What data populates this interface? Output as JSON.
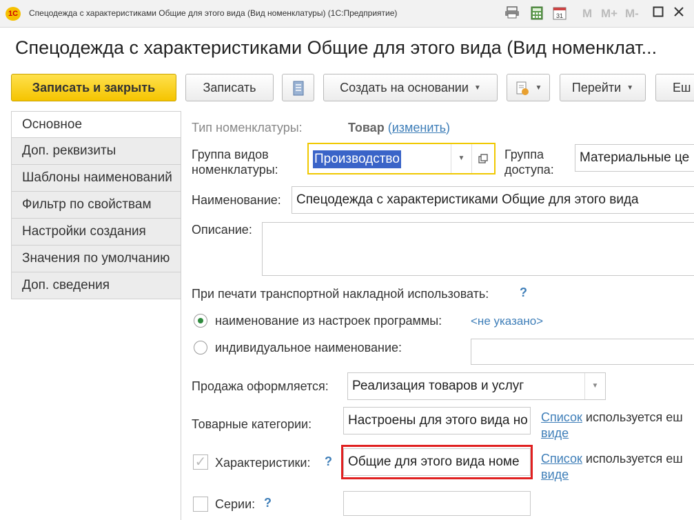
{
  "window": {
    "title": "Спецодежда с характеристиками Общие для этого вида (Вид номенклатуры)  (1С:Предприятие)",
    "logo_text": "1С",
    "calendar_day": "31",
    "buttons": [
      "M",
      "M+",
      "M-"
    ]
  },
  "form": {
    "title": "Спецодежда с характеристиками Общие для этого вида (Вид номенклат..."
  },
  "toolbar": {
    "save_close": "Записать и закрыть",
    "save": "Записать",
    "create_based": "Создать на основании",
    "goto": "Перейти",
    "more": "Еш"
  },
  "nav": {
    "items": [
      "Основное",
      "Доп. реквизиты",
      "Шаблоны наименований",
      "Фильтр по свойствам",
      "Настройки создания",
      "Значения по умолчанию",
      "Доп. сведения"
    ]
  },
  "fields": {
    "type_label": "Тип номенклатуры:",
    "type_value": "Товар",
    "type_change_open": "(",
    "type_change_link": "изменить",
    "type_change_close": ")",
    "group_label": "Группа видов номенклатуры:",
    "group_value": "Производство",
    "access_label": "Группа доступа:",
    "access_value": "Материальные це",
    "name_label": "Наименование:",
    "name_value": "Спецодежда с характеристиками Общие для этого вида",
    "desc_label": "Описание:",
    "print_label": "При печати транспортной накладной использовать:",
    "print_help": "?",
    "radio1_label": "наименование из настроек программы:",
    "radio1_value": "<не указано>",
    "radio2_label": "индивидуальное наименование:",
    "sale_label": "Продажа оформляется:",
    "sale_value": "Реализация товаров и услуг",
    "cat_label": "Товарные категории:",
    "cat_value": "Настроены для этого вида но",
    "cat_link": "Список",
    "cat_text": "используется еш",
    "cat_link2": "виде",
    "char_label": "Характеристики:",
    "char_help": "?",
    "char_value": "Общие для этого вида номе",
    "char_link": "Список",
    "char_text": "используется еш",
    "char_link2": "виде",
    "series_label": "Серии:",
    "series_help": "?"
  },
  "colors": {
    "highlight_border": "#e02020",
    "focus_border": "#f0c800",
    "selection": "#3a64c8",
    "link": "#3e7eb8"
  }
}
